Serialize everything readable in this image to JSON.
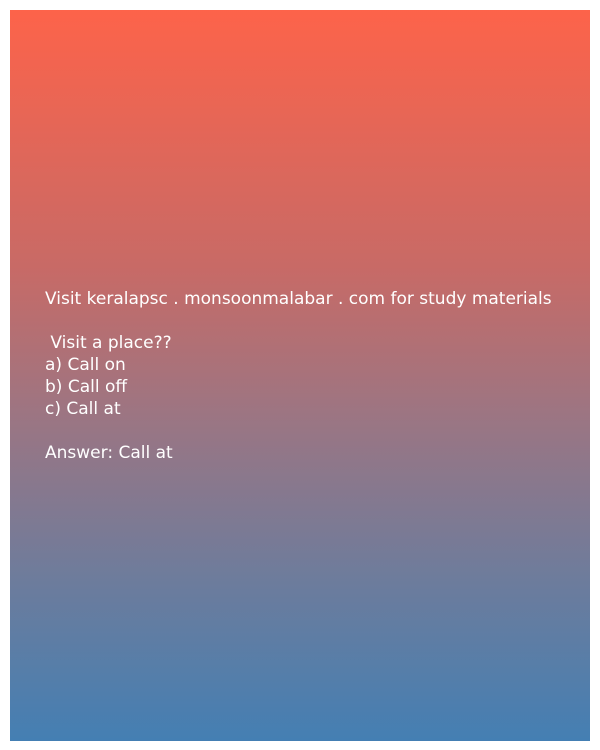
{
  "promo": "Visit keralapsc . monsoonmalabar . com for study materials",
  "question": " Visit a place??",
  "options": [
    "a) Call on",
    "b) Call off",
    "c) Call at"
  ],
  "answer": "Answer: Call at"
}
